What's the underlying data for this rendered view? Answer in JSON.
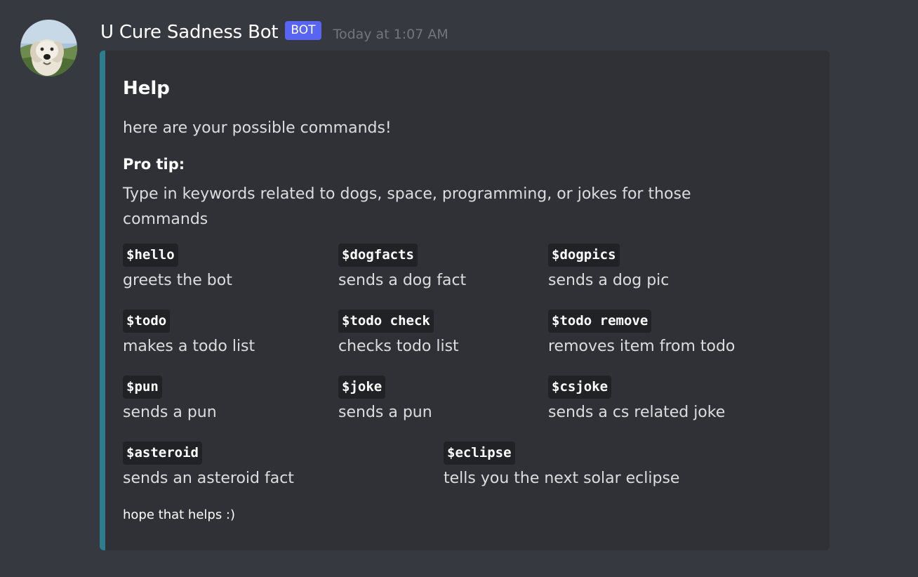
{
  "message": {
    "avatar_icon": "dog-avatar",
    "username": "U Cure Sadness Bot",
    "bot_tag": "BOT",
    "timestamp": "Today at 1:07 AM"
  },
  "embed": {
    "accent_color": "#2e7d8c",
    "title": "Help",
    "description": "here are your possible commands!",
    "pro_tip": {
      "title": "Pro tip:",
      "value": "Type in keywords related to dogs, space, programming, or jokes for those commands"
    },
    "fields": [
      {
        "command": "$hello",
        "description": "greets the bot"
      },
      {
        "command": "$dogfacts",
        "description": "sends a dog fact"
      },
      {
        "command": "$dogpics",
        "description": "sends a dog pic"
      },
      {
        "command": "$todo",
        "description": "makes a todo list"
      },
      {
        "command": "$todo check",
        "description": "checks todo list"
      },
      {
        "command": "$todo remove",
        "description": "removes item from todo"
      },
      {
        "command": "$pun",
        "description": "sends a pun"
      },
      {
        "command": "$joke",
        "description": "sends a pun"
      },
      {
        "command": "$csjoke",
        "description": "sends a cs related joke"
      },
      {
        "command": "$asteroid",
        "description": "sends an asteroid fact"
      },
      {
        "command": "$eclipse",
        "description": "tells you the next solar eclipse"
      }
    ],
    "footer": "hope that helps :)"
  }
}
